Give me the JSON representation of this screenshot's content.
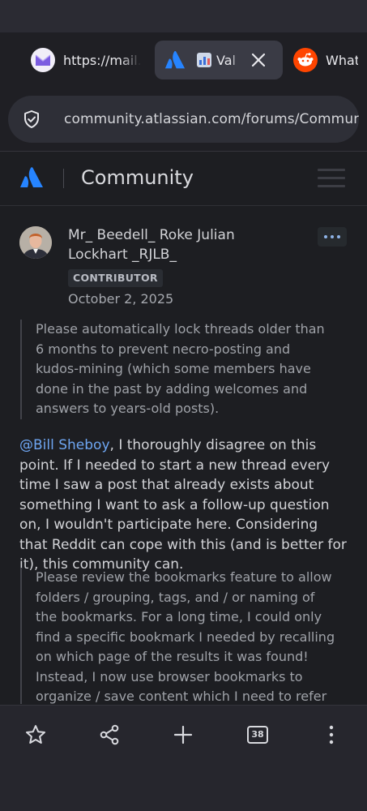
{
  "tabs": [
    {
      "title": "https://mail.proton.me",
      "icon": "proton-mail-icon"
    },
    {
      "title": "Val",
      "icon": "atlassian-icon",
      "prefix_icon": "bar-chart-emoji-icon",
      "active": true
    },
    {
      "title": "What",
      "icon": "reddit-icon"
    }
  ],
  "urlbar": {
    "url": "community.atlassian.com/forums/Community"
  },
  "site": {
    "brand": "Community"
  },
  "post": {
    "author": "Mr_ Beedell_ Roke Julian Lockhart _RJLB_",
    "badge": "CONTRIBUTOR",
    "date": "October 2, 2025",
    "quote1": "Please automatically lock threads older than 6 months to prevent necro-posting and kudos-mining (which some members have done in the past by adding welcomes and answers to years-old posts).",
    "mention": "@Bill Sheboy",
    "reply": ", I thoroughly disagree on this point. If I needed to start a new thread every time I saw a post that already exists about something I want to ask a follow-up question on, I wouldn't participate here. Considering that Reddit can cope with this (and is better for it), this community can.",
    "quote2": "Please review the bookmarks feature to allow folders / grouping, tags, and / or naming of the bookmarks. For a long time, I could only find a specific bookmark I needed by recalling on which page of the results it was found! Instead, I now use browser bookmarks to organize / save content which I need to refer to later."
  },
  "bottom": {
    "tab_count": "38"
  },
  "colors": {
    "accent": "#6ea6f2",
    "background": "#1d1e22",
    "reddit": "#ff4500",
    "atlassian": "#2684ff"
  }
}
